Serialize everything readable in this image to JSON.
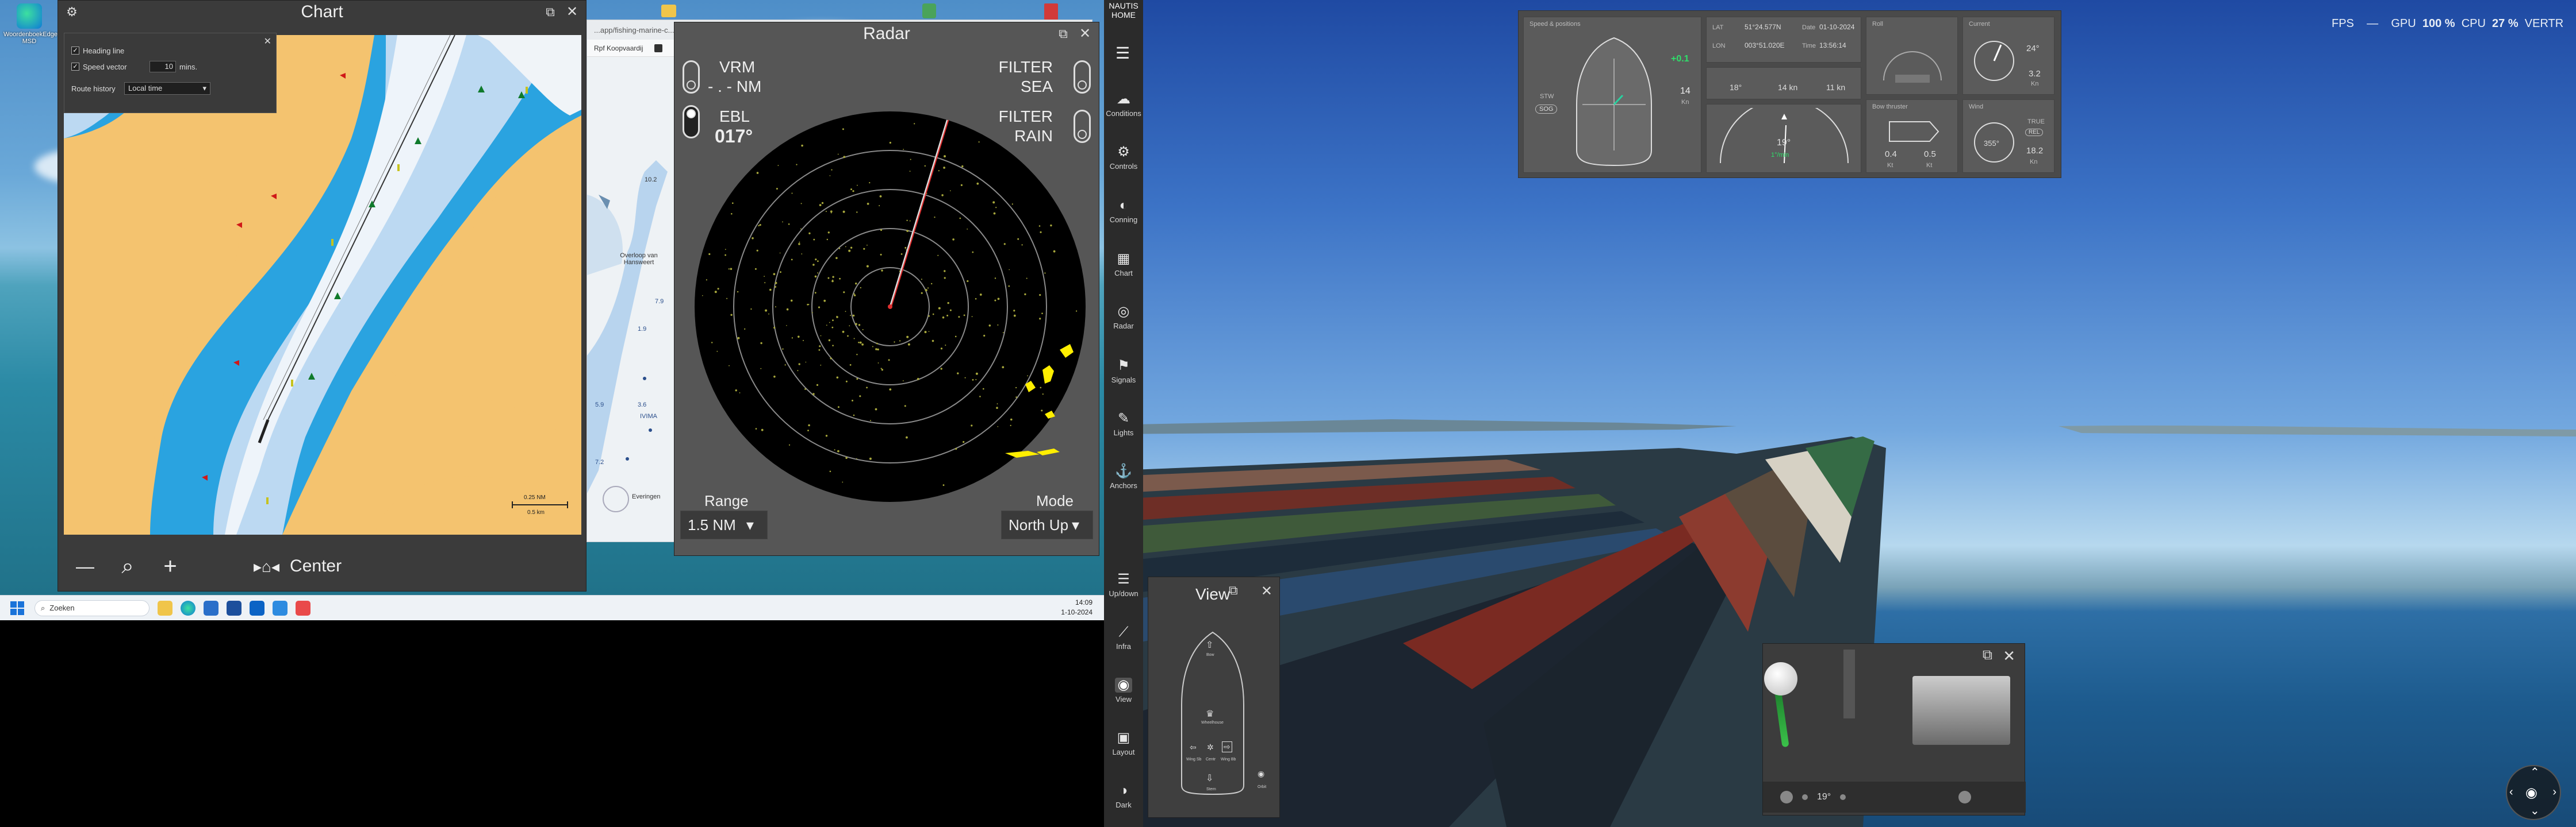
{
  "desktop": {
    "icon_label": "WoordenboekEdge-MSD"
  },
  "taskbar": {
    "search_placeholder": "Zoeken",
    "time": "14:09",
    "date": "1-10-2024"
  },
  "browser": {
    "url": "...app/fishing-marine-c...",
    "tab1": "Rpf Koopvaardij",
    "map_label_1": "Overloop van Hansweert",
    "map_label_2": "Everingen",
    "map_labels_small": [
      "10.2",
      "1.9",
      "7.9",
      "7.2",
      "5.9",
      "3.6",
      "IVIMA"
    ]
  },
  "chart": {
    "title": "Chart",
    "settings": {
      "heading_line": "Heading line",
      "speed_vector": "Speed vector",
      "speed_vector_value": "10",
      "speed_vector_unit": "mins.",
      "route_history": "Route history",
      "route_history_value": "Local time"
    },
    "scale_top": "0.25 NM",
    "scale_bottom": "0.5 km",
    "toolbar": {
      "zoom_out": "—",
      "search": "⌕",
      "zoom_in": "+",
      "center": "Center"
    }
  },
  "radar": {
    "title": "Radar",
    "vrm_label": "VRM",
    "vrm_value": "- . - NM",
    "ebl_label": "EBL",
    "ebl_value": "017°",
    "filter_sea_1": "FILTER",
    "filter_sea_2": "SEA",
    "filter_rain_1": "FILTER",
    "filter_rain_2": "RAIN",
    "range_label": "Range",
    "range_value": "1.5 NM",
    "mode_label": "Mode",
    "mode_value": "North Up",
    "heading_deg": 17
  },
  "sidebar": {
    "brand_1": "NAUTIS",
    "brand_2": "HOME",
    "items": [
      {
        "label": "Conditions",
        "icon": "cloud-icon"
      },
      {
        "label": "Controls",
        "icon": "controls-icon"
      },
      {
        "label": "Conning",
        "icon": "conning-icon"
      },
      {
        "label": "Chart",
        "icon": "chart-icon"
      },
      {
        "label": "Radar",
        "icon": "radar-icon"
      },
      {
        "label": "Signals",
        "icon": "signals-icon"
      },
      {
        "label": "Lights",
        "icon": "lights-icon"
      },
      {
        "label": "Anchors",
        "icon": "anchor-icon"
      },
      {
        "label": "Up/down",
        "icon": "updown-icon"
      },
      {
        "label": "Infra",
        "icon": "infra-icon"
      },
      {
        "label": "View",
        "icon": "eye-icon"
      },
      {
        "label": "Layout",
        "icon": "layout-icon"
      },
      {
        "label": "Dark",
        "icon": "dark-icon"
      }
    ]
  },
  "hud": {
    "fps": "FPS",
    "dash1": "—",
    "gpu": "GPU",
    "gpu_val": "100 %",
    "cpu": "CPU",
    "cpu_val": "27 %",
    "vertr": "VERTR"
  },
  "conning": {
    "speed_header": "Speed & positions",
    "stw": "STW",
    "sog": "SOG",
    "roll_rate": "+0.1",
    "speed_fwd": "14",
    "speed_unit": "Kn",
    "lat_label": "LAT",
    "lat_value": "51°24.577N",
    "lon_label": "LON",
    "lon_value": "003°51.020E",
    "date_label": "Date",
    "date_value": "01-10-2024",
    "time_label": "Time",
    "time_value": "13:56:14",
    "heading_val": "18°",
    "cog_val": "14 kn",
    "sog_val": "11 kn",
    "roll_label": "Roll",
    "current_label": "Current",
    "current_dir": "24°",
    "current_speed": "3.2",
    "current_unit": "Kn",
    "rudder_value": "19°",
    "rudder_sub": "1°/min",
    "bow_label": "Bow thruster",
    "bow_left": "0.4",
    "bow_right": "0.5",
    "bow_unit": "Kt",
    "wind_label": "Wind",
    "wind_dir": "355°",
    "wind_true": "TRUE",
    "wind_rel": "REL",
    "wind_speed": "18.2",
    "wind_unit": "Kn"
  },
  "view": {
    "title": "View",
    "cam_labels": [
      "Bow",
      "Wheelhouse",
      "Wing Sb",
      "Centr",
      "Wing Bb",
      "Stern",
      "Orbit"
    ]
  },
  "throttle": {
    "rudder_readout": "19°"
  }
}
